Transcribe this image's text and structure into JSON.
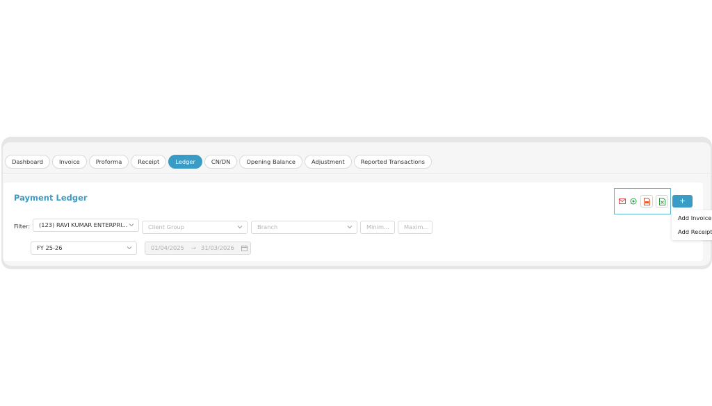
{
  "tabs": [
    {
      "label": "Dashboard",
      "active": false
    },
    {
      "label": "Invoice",
      "active": false
    },
    {
      "label": "Proforma",
      "active": false
    },
    {
      "label": "Receipt",
      "active": false
    },
    {
      "label": "Ledger",
      "active": true
    },
    {
      "label": "CN/DN",
      "active": false
    },
    {
      "label": "Opening Balance",
      "active": false
    },
    {
      "label": "Adjustment",
      "active": false
    },
    {
      "label": "Reported Transactions",
      "active": false
    }
  ],
  "page": {
    "title": "Payment Ledger"
  },
  "actions": {
    "icons": [
      "mail-icon",
      "whatsapp-icon",
      "pdf-export-icon",
      "excel-export-icon"
    ],
    "add_label": "+"
  },
  "filters": {
    "label": "Filter:",
    "client_value": "(123) RAVI KUMAR ENTERPRI...",
    "client_group_placeholder": "Client Group",
    "branch_placeholder": "Branch",
    "min_placeholder": "Minim...",
    "max_placeholder": "Maxim...",
    "fy_value": "FY 25-26",
    "date_from": "01/04/2025",
    "date_to": "31/03/2026"
  },
  "dropdown": {
    "items": [
      "Add Invoice",
      "Add Receipt"
    ]
  },
  "colors": {
    "accent": "#3a9bc4",
    "mail": "#e0474c",
    "whatsapp": "#25a244",
    "pdf": "#e8552f",
    "excel": "#2e9e45"
  }
}
